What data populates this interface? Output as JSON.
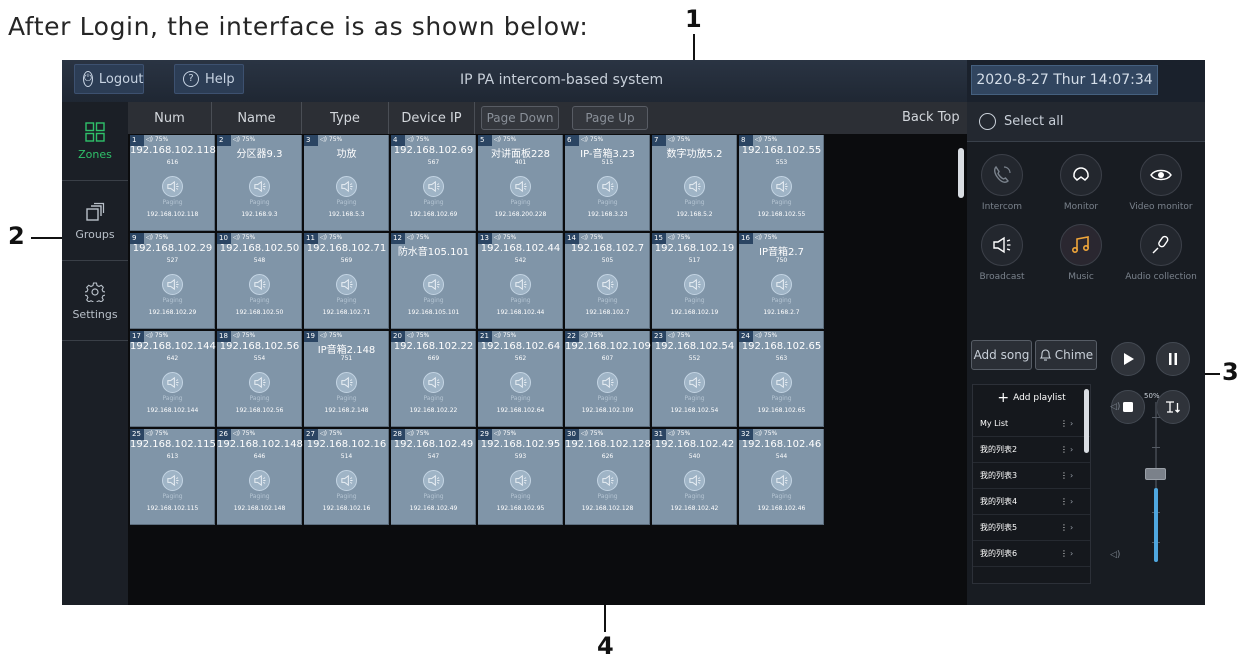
{
  "caption": "After Login, the interface is as shown below:",
  "callouts": [
    "1",
    "2",
    "3",
    "4"
  ],
  "topbar": {
    "logout_label": "Logout",
    "help_label": "Help",
    "title": "IP PA intercom-based system",
    "datetime": "2020-8-27 Thur 14:07:34"
  },
  "sidebar": {
    "items": [
      {
        "label": "Zones",
        "icon": "grid-icon"
      },
      {
        "label": "Groups",
        "icon": "stack-icon"
      },
      {
        "label": "Settings",
        "icon": "gear-icon"
      }
    ]
  },
  "table": {
    "headers": [
      "Num",
      "Name",
      "Type",
      "Device IP"
    ],
    "page_down": "Page Down",
    "page_up": "Page Up",
    "back_top": "Back Top"
  },
  "zones": [
    {
      "num": "1",
      "vol": "75%",
      "name": "192.168.102.118",
      "code": "616",
      "status": "Paging",
      "ip": "192.168.102.118"
    },
    {
      "num": "2",
      "vol": "75%",
      "name": "分区器9.3",
      "code": "",
      "status": "Paging",
      "ip": "192.168.9.3"
    },
    {
      "num": "3",
      "vol": "75%",
      "name": "功放",
      "code": "",
      "status": "Paging",
      "ip": "192.168.5.3"
    },
    {
      "num": "4",
      "vol": "75%",
      "name": "192.168.102.69",
      "code": "567",
      "status": "Paging",
      "ip": "192.168.102.69"
    },
    {
      "num": "5",
      "vol": "75%",
      "name": "对讲面板228",
      "code": "401",
      "status": "Paging",
      "ip": "192.168.200.228"
    },
    {
      "num": "6",
      "vol": "75%",
      "name": "IP-音箱3.23",
      "code": "515",
      "status": "Paging",
      "ip": "192.168.3.23"
    },
    {
      "num": "7",
      "vol": "75%",
      "name": "数字功放5.2",
      "code": "",
      "status": "Paging",
      "ip": "192.168.5.2"
    },
    {
      "num": "8",
      "vol": "75%",
      "name": "192.168.102.55",
      "code": "553",
      "status": "Paging",
      "ip": "192.168.102.55"
    },
    {
      "num": "9",
      "vol": "75%",
      "name": "192.168.102.29",
      "code": "527",
      "status": "Paging",
      "ip": "192.168.102.29"
    },
    {
      "num": "10",
      "vol": "75%",
      "name": "192.168.102.50",
      "code": "548",
      "status": "Paging",
      "ip": "192.168.102.50"
    },
    {
      "num": "11",
      "vol": "75%",
      "name": "192.168.102.71",
      "code": "569",
      "status": "Paging",
      "ip": "192.168.102.71"
    },
    {
      "num": "12",
      "vol": "75%",
      "name": "防水音105.101",
      "code": "",
      "status": "Paging",
      "ip": "192.168.105.101"
    },
    {
      "num": "13",
      "vol": "75%",
      "name": "192.168.102.44",
      "code": "542",
      "status": "Paging",
      "ip": "192.168.102.44"
    },
    {
      "num": "14",
      "vol": "75%",
      "name": "192.168.102.7",
      "code": "505",
      "status": "Paging",
      "ip": "192.168.102.7"
    },
    {
      "num": "15",
      "vol": "75%",
      "name": "192.168.102.19",
      "code": "517",
      "status": "Paging",
      "ip": "192.168.102.19"
    },
    {
      "num": "16",
      "vol": "75%",
      "name": "IP音箱2.7",
      "code": "750",
      "status": "Paging",
      "ip": "192.168.2.7"
    },
    {
      "num": "17",
      "vol": "75%",
      "name": "192.168.102.144",
      "code": "642",
      "status": "Paging",
      "ip": "192.168.102.144"
    },
    {
      "num": "18",
      "vol": "75%",
      "name": "192.168.102.56",
      "code": "554",
      "status": "Paging",
      "ip": "192.168.102.56"
    },
    {
      "num": "19",
      "vol": "75%",
      "name": "IP音箱2.148",
      "code": "751",
      "status": "Paging",
      "ip": "192.168.2.148"
    },
    {
      "num": "20",
      "vol": "75%",
      "name": "192.168.102.22",
      "code": "669",
      "status": "Paging",
      "ip": "192.168.102.22"
    },
    {
      "num": "21",
      "vol": "75%",
      "name": "192.168.102.64",
      "code": "562",
      "status": "Paging",
      "ip": "192.168.102.64"
    },
    {
      "num": "22",
      "vol": "75%",
      "name": "192.168.102.109",
      "code": "607",
      "status": "Paging",
      "ip": "192.168.102.109"
    },
    {
      "num": "23",
      "vol": "75%",
      "name": "192.168.102.54",
      "code": "552",
      "status": "Paging",
      "ip": "192.168.102.54"
    },
    {
      "num": "24",
      "vol": "75%",
      "name": "192.168.102.65",
      "code": "563",
      "status": "Paging",
      "ip": "192.168.102.65"
    },
    {
      "num": "25",
      "vol": "75%",
      "name": "192.168.102.115",
      "code": "613",
      "status": "Paging",
      "ip": "192.168.102.115"
    },
    {
      "num": "26",
      "vol": "75%",
      "name": "192.168.102.148",
      "code": "646",
      "status": "Paging",
      "ip": "192.168.102.148"
    },
    {
      "num": "27",
      "vol": "75%",
      "name": "192.168.102.16",
      "code": "514",
      "status": "Paging",
      "ip": "192.168.102.16"
    },
    {
      "num": "28",
      "vol": "75%",
      "name": "192.168.102.49",
      "code": "547",
      "status": "Paging",
      "ip": "192.168.102.49"
    },
    {
      "num": "29",
      "vol": "75%",
      "name": "192.168.102.95",
      "code": "593",
      "status": "Paging",
      "ip": "192.168.102.95"
    },
    {
      "num": "30",
      "vol": "75%",
      "name": "192.168.102.128",
      "code": "626",
      "status": "Paging",
      "ip": "192.168.102.128"
    },
    {
      "num": "31",
      "vol": "75%",
      "name": "192.168.102.42",
      "code": "540",
      "status": "Paging",
      "ip": "192.168.102.42"
    },
    {
      "num": "32",
      "vol": "75%",
      "name": "192.168.102.46",
      "code": "544",
      "status": "Paging",
      "ip": "192.168.102.46"
    }
  ],
  "right_panel": {
    "select_all": "Select all",
    "functions": [
      {
        "label": "Intercom",
        "icon": "phone-icon"
      },
      {
        "label": "Monitor",
        "icon": "headset-icon"
      },
      {
        "label": "Video monitor",
        "icon": "eye-icon"
      },
      {
        "label": "Broadcast",
        "icon": "megaphone-icon"
      },
      {
        "label": "Music",
        "icon": "music-note-icon"
      },
      {
        "label": "Audio collection",
        "icon": "microphone-icon"
      }
    ],
    "add_song": "Add song",
    "chime": "Chime",
    "add_playlist": "Add playlist",
    "playlists": [
      "My List",
      "我的列表2",
      "我的列表3",
      "我的列表4",
      "我的列表5",
      "我的列表6"
    ],
    "volume": "50%",
    "volume_level": 0.5
  },
  "colors": {
    "accent_green": "#2fc06a",
    "tile": "#8095a8",
    "music_orange": "#f0a63a",
    "volume_blue": "#4fa7e0"
  }
}
